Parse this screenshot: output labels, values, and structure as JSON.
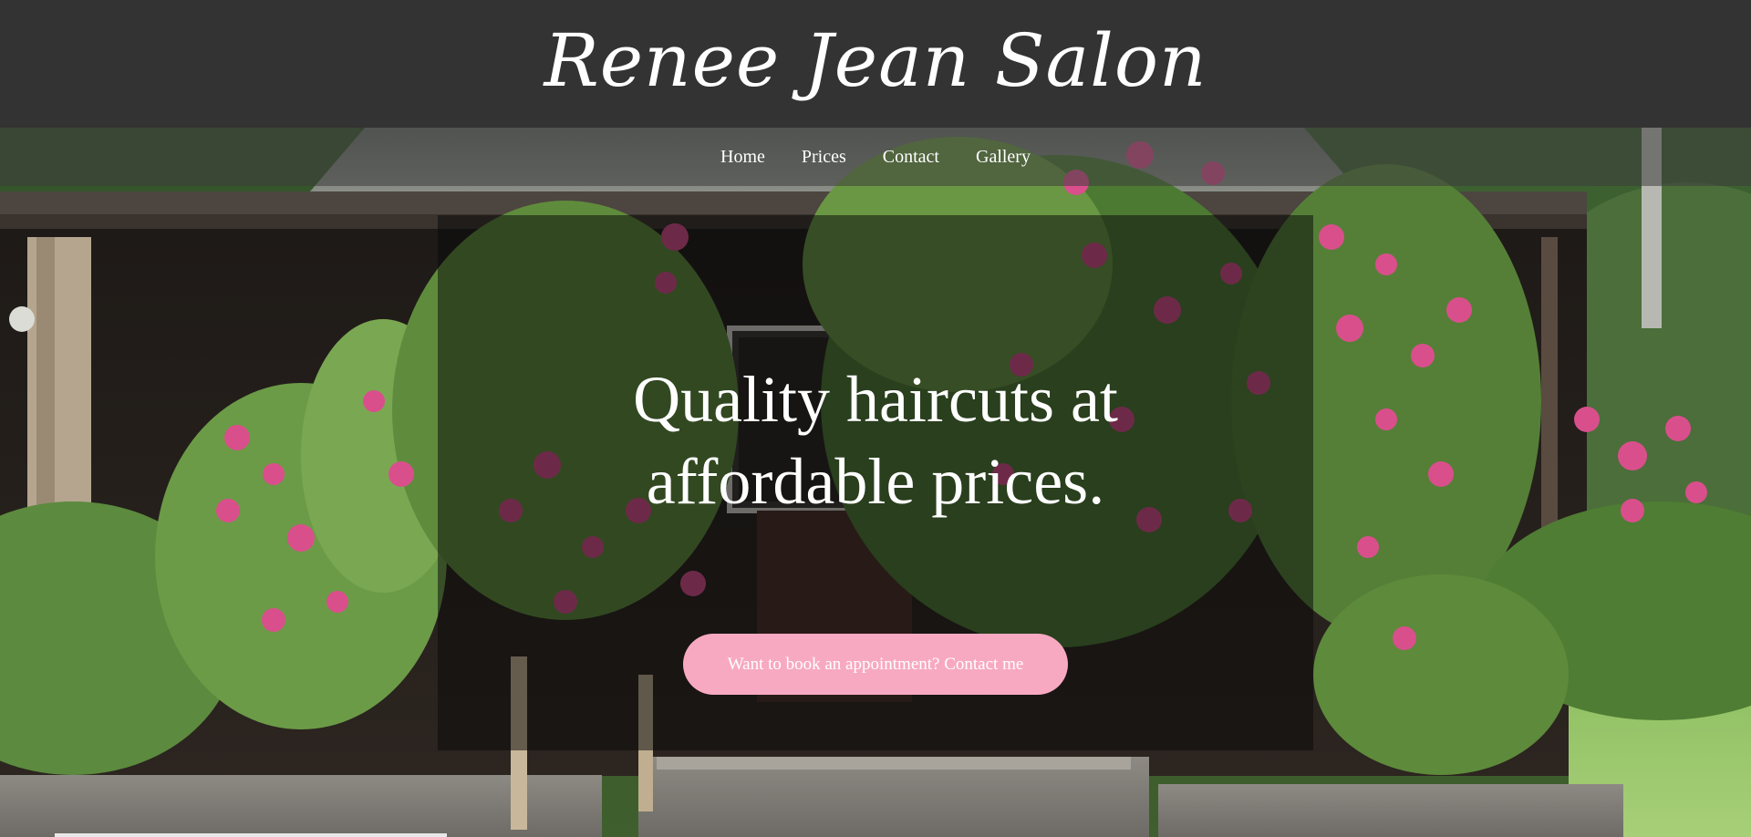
{
  "header": {
    "title": "Renee Jean Salon"
  },
  "nav": {
    "items": [
      {
        "label": "Home"
      },
      {
        "label": "Prices"
      },
      {
        "label": "Contact"
      },
      {
        "label": "Gallery"
      }
    ]
  },
  "hero": {
    "heading_line1": "Quality haircuts at",
    "heading_line2": "affordable prices.",
    "cta_label": "Want to book an appointment? Contact me",
    "background_subject": "house porch with pink rose bushes",
    "colors": {
      "cta": "#f8a9c2",
      "header_bg": "#333333",
      "rose_pink": "#d94f8c",
      "foliage": "#4e7a35"
    }
  }
}
